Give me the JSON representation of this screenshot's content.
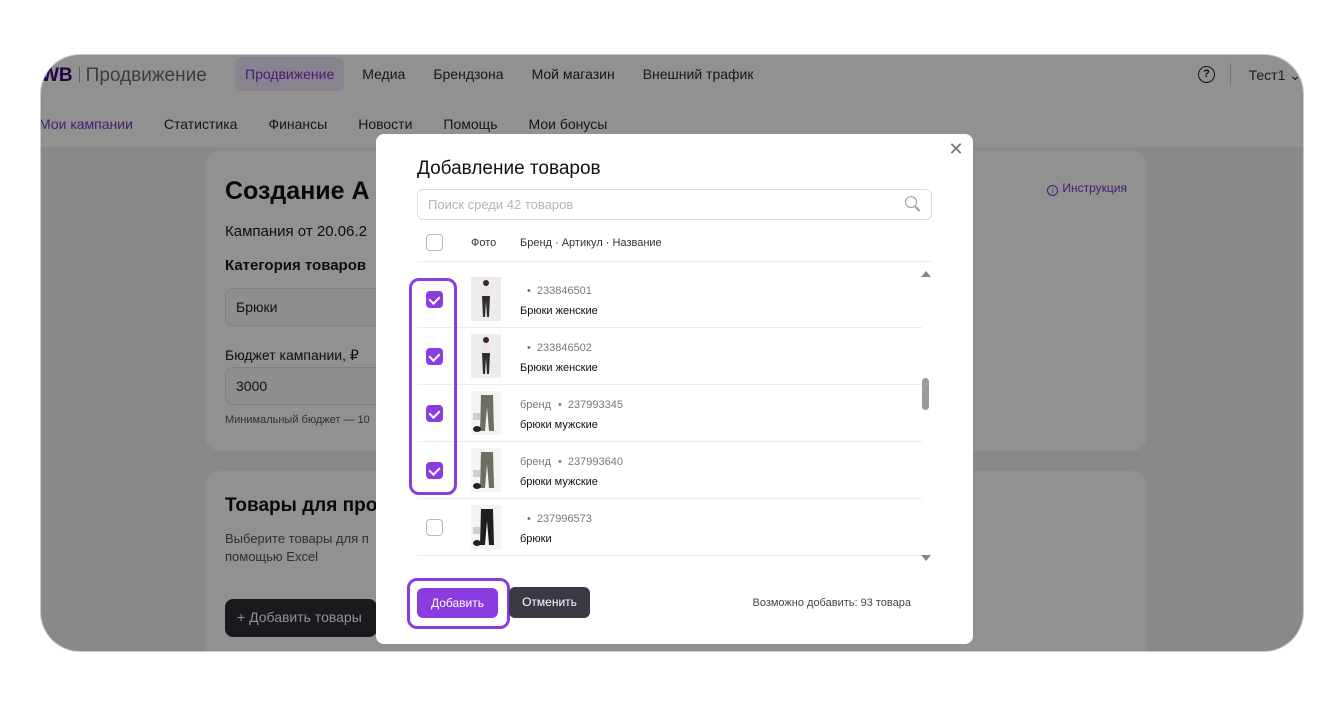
{
  "header": {
    "logo_brand": "WB",
    "logo_product": "Продвижение",
    "nav": [
      "Продвижение",
      "Медиа",
      "Брендзона",
      "Мой магазин",
      "Внешний трафик"
    ],
    "help_icon": "question-circle-icon",
    "user_name": "Тест1 ⌄"
  },
  "subnav": [
    "Мои кампании",
    "Статистика",
    "Финансы",
    "Новости",
    "Помощь",
    "Мои бонусы"
  ],
  "campaign_card": {
    "title": "Создание А",
    "subtitle": "Кампания от 20.06.2",
    "category_label": "Категория товаров",
    "category_value": "Брюки",
    "budget_label": "Бюджет кампании, ₽",
    "budget_value": "3000",
    "budget_hint": "Минимальный бюджет — 10",
    "instruction_link": "Инструкция"
  },
  "products_card": {
    "title": "Товары для про",
    "hint_line1": "Выберите товары для п",
    "hint_line2": "помощью Excel",
    "add_button": "+ Добавить товары"
  },
  "modal": {
    "title": "Добавление товаров",
    "search_placeholder": "Поиск среди 42 товаров",
    "columns": {
      "photo": "Фото",
      "info": "Бренд · Артикул · Название"
    },
    "rows": [
      {
        "checked": true,
        "brand": "",
        "article": "233846501",
        "name": "Брюки женские",
        "thumb": "woman-pants"
      },
      {
        "checked": true,
        "brand": "",
        "article": "233846502",
        "name": "Брюки женские",
        "thumb": "woman-pants"
      },
      {
        "checked": true,
        "brand": "бренд",
        "article": "237993345",
        "name": "брюки мужские",
        "thumb": "olive-pants"
      },
      {
        "checked": true,
        "brand": "бренд",
        "article": "237993640",
        "name": "брюки мужские",
        "thumb": "olive-pants"
      },
      {
        "checked": false,
        "brand": "",
        "article": "237996573",
        "name": "брюки",
        "thumb": "black-pants"
      }
    ],
    "add_button": "Добавить",
    "cancel_button": "Отменить",
    "can_add_text": "Возможно добавить: 93 товара"
  },
  "colors": {
    "accent": "#8a3ce0",
    "dark_button": "#3a3a44"
  }
}
